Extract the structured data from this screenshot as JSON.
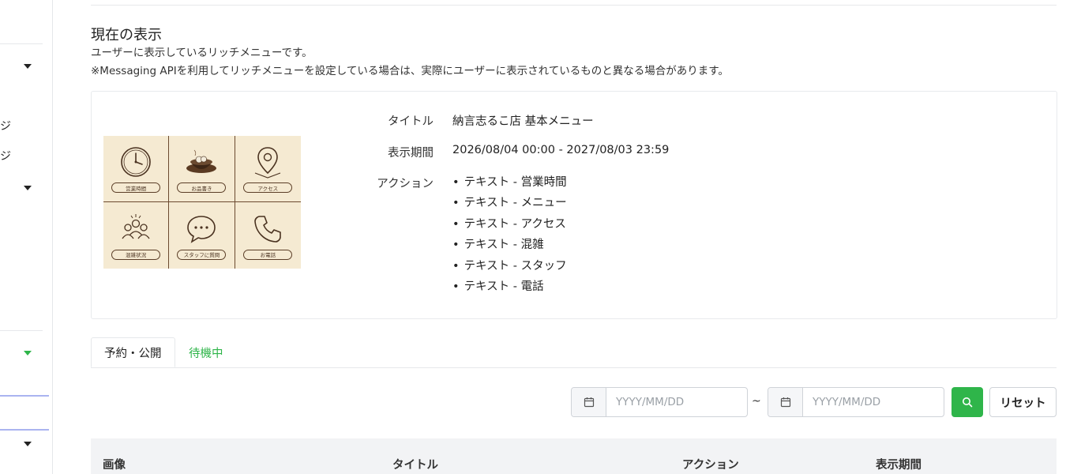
{
  "sidebar": {
    "partial_chars": [
      "ジ",
      "ジ"
    ]
  },
  "section": {
    "title": "現在の表示",
    "description": "ユーザーに表示しているリッチメニューです。",
    "note": "※Messaging APIを利用してリッチメニューを設定している場合は、実際にユーザーに表示されているものと異なる場合があります。"
  },
  "rich_menu": {
    "image_cells": [
      {
        "icon": "clock-icon",
        "label": "営業時間"
      },
      {
        "icon": "food-bowl-icon",
        "label": "お品書き"
      },
      {
        "icon": "map-pin-icon",
        "label": "アクセス"
      },
      {
        "icon": "people-icon",
        "label": "混雑状況"
      },
      {
        "icon": "chat-bubble-icon",
        "label": "スタッフに質問"
      },
      {
        "icon": "phone-icon",
        "label": "お電話"
      }
    ],
    "title_label": "タイトル",
    "title_value": "納言志るこ店 基本メニュー",
    "period_label": "表示期間",
    "period_value": "2026/08/04 00:00 - 2027/08/03 23:59",
    "actions_label": "アクション",
    "actions": [
      "テキスト - 営業時間",
      "テキスト - メニュー",
      "テキスト - アクセス",
      "テキスト - 混雑",
      "テキスト - スタッフ",
      "テキスト - 電話"
    ]
  },
  "tabs": [
    {
      "label": "予約・公開",
      "active": true
    },
    {
      "label": "待機中",
      "active": false
    }
  ],
  "filter": {
    "start_placeholder": "YYYY/MM/DD",
    "end_placeholder": "YYYY/MM/DD",
    "separator": "~",
    "reset_label": "リセット"
  },
  "table": {
    "headers": [
      "画像",
      "タイトル",
      "アクション",
      "表示期間"
    ]
  },
  "colors": {
    "accent_green": "#2fb54a",
    "sidebar_highlight": "#aab4f0",
    "menu_background": "#f5ead2",
    "menu_line": "#6b4a30"
  }
}
